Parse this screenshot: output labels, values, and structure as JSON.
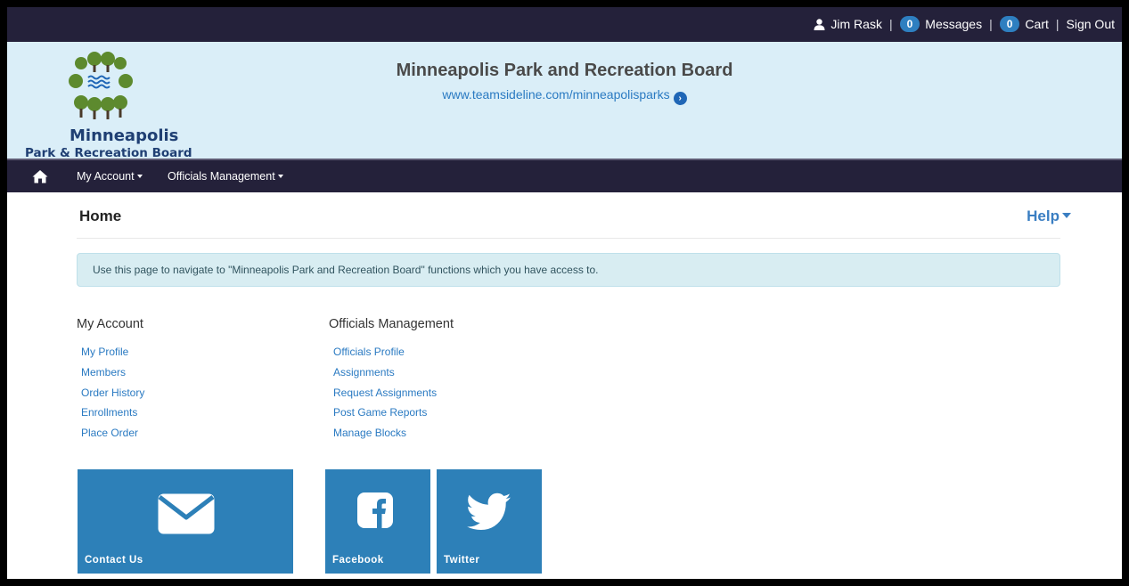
{
  "topbar": {
    "user_name": "Jim Rask",
    "messages_count": "0",
    "messages_label": "Messages",
    "cart_count": "0",
    "cart_label": "Cart",
    "sign_out_label": "Sign Out",
    "separator": "|"
  },
  "banner": {
    "logo_line1": "Minneapolis",
    "logo_line2": "Park & Recreation Board",
    "org_title": "Minneapolis Park and Recreation Board",
    "org_url": "www.teamsideline.com/minneapolisparks",
    "colors": {
      "background": "#daeef8",
      "logo_green": "#5d8a2e",
      "logo_blue": "#1f3f73"
    }
  },
  "nav": {
    "home_icon": "home-icon",
    "items": [
      {
        "label": "My Account"
      },
      {
        "label": "Officials Management"
      }
    ]
  },
  "page": {
    "title": "Home",
    "help_label": "Help",
    "info_message": "Use this page to navigate to \"Minneapolis Park and Recreation Board\" functions which you have access to."
  },
  "sections": [
    {
      "title": "My Account",
      "links": [
        "My Profile",
        "Members",
        "Order History",
        "Enrollments",
        "Place Order"
      ]
    },
    {
      "title": "Officials Management",
      "links": [
        "Officials Profile",
        "Assignments",
        "Request Assignments",
        "Post Game Reports",
        "Manage Blocks"
      ]
    }
  ],
  "tiles": [
    {
      "label": "Contact Us",
      "icon": "envelope-icon"
    },
    {
      "label": "Facebook",
      "icon": "facebook-icon"
    },
    {
      "label": "Twitter",
      "icon": "twitter-icon"
    }
  ],
  "colors": {
    "dark_bar": "#24213a",
    "link": "#2a7ac2",
    "tile": "#2d80b8",
    "badge": "#2e7fc0"
  }
}
